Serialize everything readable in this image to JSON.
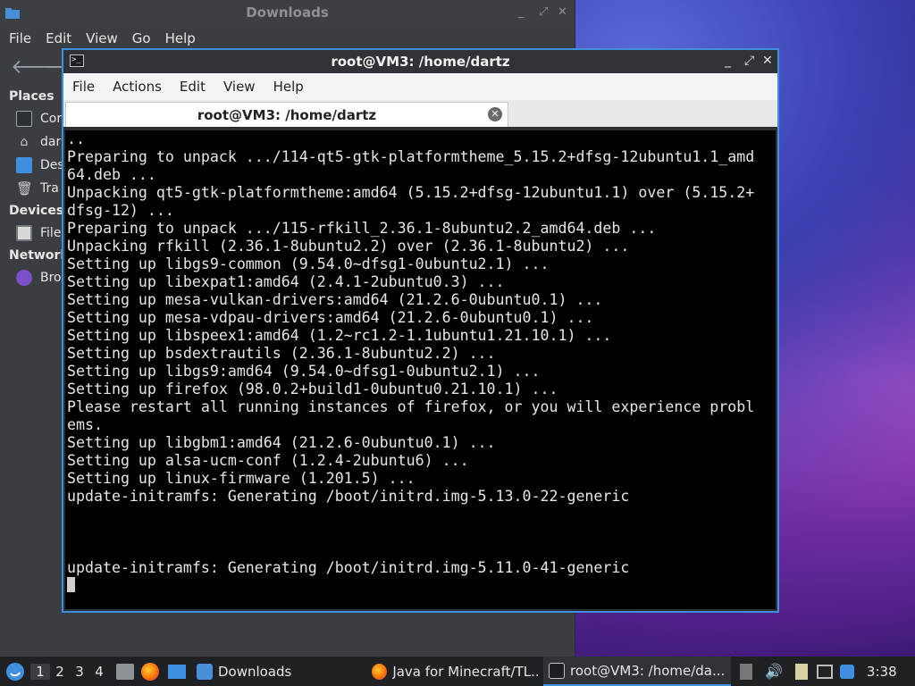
{
  "file_manager": {
    "title": "Downloads",
    "menu": [
      "File",
      "Edit",
      "View",
      "Go",
      "Help"
    ],
    "sidebar": {
      "places_heading": "Places",
      "places": [
        "Cor",
        "dar",
        "Des",
        "Tra"
      ],
      "devices_heading": "Devices",
      "devices": [
        "File"
      ],
      "network_heading": "Network",
      "network": [
        "Bro"
      ]
    }
  },
  "terminal": {
    "title": "root@VM3: /home/dartz",
    "menu": [
      "File",
      "Actions",
      "Edit",
      "View",
      "Help"
    ],
    "tab_label": "root@VM3: /home/dartz",
    "output": "..\nPreparing to unpack .../114-qt5-gtk-platformtheme_5.15.2+dfsg-12ubuntu1.1_amd\n64.deb ...\nUnpacking qt5-gtk-platformtheme:amd64 (5.15.2+dfsg-12ubuntu1.1) over (5.15.2+\ndfsg-12) ...\nPreparing to unpack .../115-rfkill_2.36.1-8ubuntu2.2_amd64.deb ...\nUnpacking rfkill (2.36.1-8ubuntu2.2) over (2.36.1-8ubuntu2) ...\nSetting up libgs9-common (9.54.0~dfsg1-0ubuntu2.1) ...\nSetting up libexpat1:amd64 (2.4.1-2ubuntu0.3) ...\nSetting up mesa-vulkan-drivers:amd64 (21.2.6-0ubuntu0.1) ...\nSetting up mesa-vdpau-drivers:amd64 (21.2.6-0ubuntu0.1) ...\nSetting up libspeex1:amd64 (1.2~rc1.2-1.1ubuntu1.21.10.1) ...\nSetting up bsdextrautils (2.36.1-8ubuntu2.2) ...\nSetting up libgs9:amd64 (9.54.0~dfsg1-0ubuntu2.1) ...\nSetting up firefox (98.0.2+build1-0ubuntu0.21.10.1) ...\nPlease restart all running instances of firefox, or you will experience probl\nems.\nSetting up libgbm1:amd64 (21.2.6-0ubuntu0.1) ...\nSetting up alsa-ucm-conf (1.2.4-2ubuntu6) ...\nSetting up linux-firmware (1.201.5) ...\nupdate-initramfs: Generating /boot/initrd.img-5.13.0-22-generic\n\n\n\nupdate-initramfs: Generating /boot/initrd.img-5.11.0-41-generic"
  },
  "taskbar": {
    "workspaces": [
      "1",
      "2",
      "3",
      "4"
    ],
    "tasks": [
      {
        "label": "Downloads",
        "icon": "folder-icon"
      },
      {
        "label": "Java for Minecraft/TL...",
        "icon": "firefox-icon"
      },
      {
        "label": "root@VM3: /home/da...",
        "icon": "terminal-icon"
      }
    ],
    "clock": "3:38"
  },
  "colors": {
    "accent": "#3f8fe0",
    "terminal_bg": "#000000",
    "panel_bg": "#1f2124"
  }
}
